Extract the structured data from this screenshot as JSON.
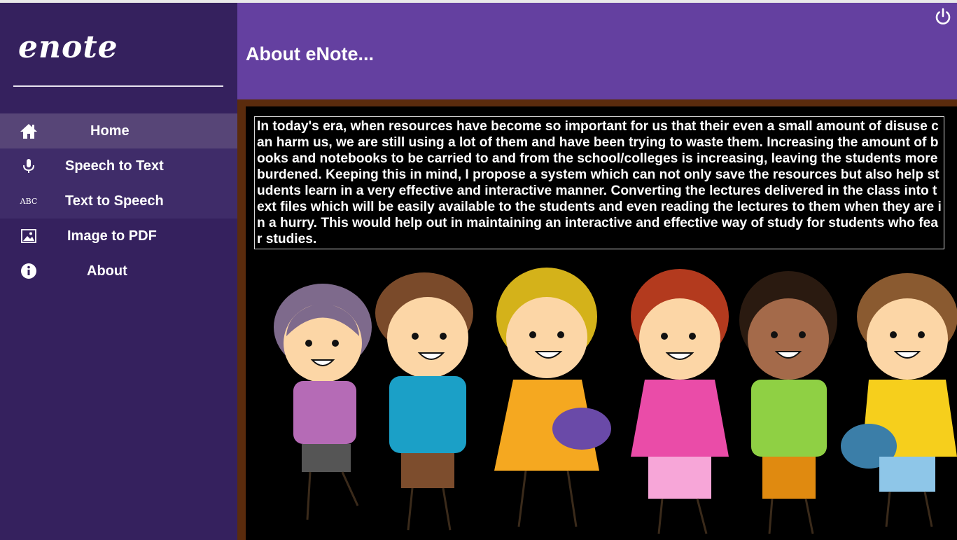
{
  "app": {
    "logo": "enote"
  },
  "sidebar": {
    "items": [
      {
        "label": "Home",
        "icon": "home-icon"
      },
      {
        "label": "Speech to Text",
        "icon": "microphone-icon"
      },
      {
        "label": "Text to Speech",
        "icon": "abc-icon",
        "icon_text": "ABC"
      },
      {
        "label": "Image to PDF",
        "icon": "image-icon"
      },
      {
        "label": "About",
        "icon": "info-icon"
      }
    ]
  },
  "header": {
    "title": "About eNote..."
  },
  "main": {
    "about_text": "In today's era, when resources have become so important for us that their even a small amount of disuse can harm us, we are still using a lot of them and have been trying to waste them. Increasing the amount of books and notebooks to be carried to and from the school/colleges is increasing, leaving the students more burdened. Keeping this in mind, I propose a system which can not only save the resources but also help students learn in a very effective and interactive manner. Converting the lectures delivered in the class into text files which will be easily available to the students and even reading the lectures to them when they are in a hurry. This would help out in maintaining an interactive and effective way of study for students who fear studies."
  },
  "colors": {
    "sidebar_bg": "#35215e",
    "sidebar_active": "#574577",
    "header_bg": "#6440a0",
    "frame_border": "#5a2b0d",
    "content_bg": "#000000"
  }
}
